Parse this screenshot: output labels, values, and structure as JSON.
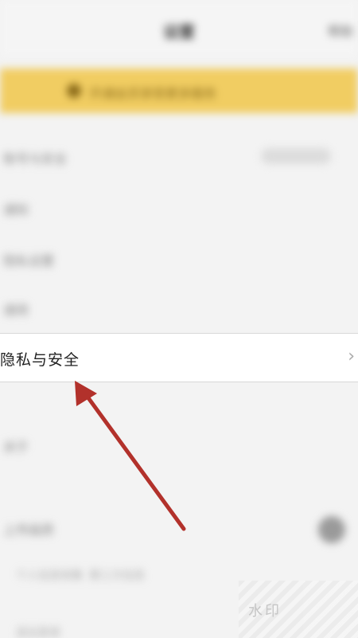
{
  "header": {
    "back_label": "",
    "title": "设置",
    "right_label": "帮助"
  },
  "vip_banner": {
    "text": "开通会员享受更多服务"
  },
  "blurred_rows": [
    {
      "label": "账号与安全",
      "value": "已绑定手机"
    },
    {
      "label": "通知",
      "value": ""
    },
    {
      "label": "隐私设置",
      "value": ""
    },
    {
      "label": "通用",
      "value": ""
    }
  ],
  "privacy_row": {
    "label": "隐私与安全",
    "chevron": "›"
  },
  "lower_rows": [
    {
      "label": "关于",
      "value": ""
    },
    {
      "label": "上传画质",
      "value": ""
    }
  ],
  "footer": {
    "text_a": "个人信息收集",
    "text_b": "第三方信息",
    "text_c": "退出登录"
  },
  "watermark": {
    "text": "水印"
  },
  "colors": {
    "banner": "#f1cd62",
    "arrow": "#b2312b"
  }
}
